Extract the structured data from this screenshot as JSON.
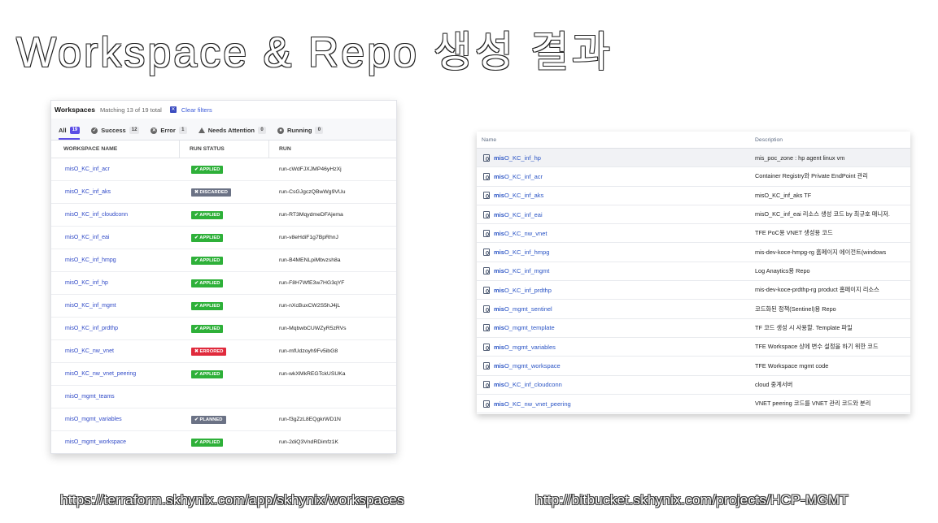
{
  "slide_title": "Workspace & Repo 생성 결과",
  "terraform": {
    "header": {
      "title": "Workspaces",
      "matching": "Matching 13 of 19 total",
      "clear_filters": "Clear filters"
    },
    "tabs": [
      {
        "label": "All",
        "count": "19",
        "icon": ""
      },
      {
        "label": "Success",
        "count": "12",
        "icon": "check-circle-icon"
      },
      {
        "label": "Error",
        "count": "1",
        "icon": "error-circle-icon"
      },
      {
        "label": "Needs Attention",
        "count": "0",
        "icon": "warning-triangle-icon"
      },
      {
        "label": "Running",
        "count": "0",
        "icon": "running-circle-icon"
      }
    ],
    "columns": {
      "name": "WORKSPACE NAME",
      "status": "RUN STATUS",
      "run": "RUN"
    },
    "rows": [
      {
        "name": "misO_KC_inf_acr",
        "status": "APPLIED",
        "status_type": "applied",
        "run": "run-cWdFJXJMP46yHzXj"
      },
      {
        "name": "misO_KC_inf_aks",
        "status": "DISCARDED",
        "status_type": "discarded",
        "run": "run-CsGJgczQBwWg9VUu"
      },
      {
        "name": "misO_KC_inf_cloudconn",
        "status": "APPLIED",
        "status_type": "applied",
        "run": "run-RT3MqydmeDFAjema"
      },
      {
        "name": "misO_KC_inf_eai",
        "status": "APPLIED",
        "status_type": "applied",
        "run": "run-v8eHdiF1g7BpRhnJ"
      },
      {
        "name": "misO_KC_inf_hmpg",
        "status": "APPLIED",
        "status_type": "applied",
        "run": "run-B4MENLpiMbvzsh8a"
      },
      {
        "name": "misO_KC_inf_hp",
        "status": "APPLIED",
        "status_type": "applied",
        "run": "run-F8H7WfE3w7HG3qYF"
      },
      {
        "name": "misO_KC_inf_mgmt",
        "status": "APPLIED",
        "status_type": "applied",
        "run": "run-nXcBuxCW2S5hJ4jL"
      },
      {
        "name": "misO_KC_inf_prdthp",
        "status": "APPLIED",
        "status_type": "applied",
        "run": "run-MqbwbCUWZyR5zRVs"
      },
      {
        "name": "misO_KC_nw_vnet",
        "status": "ERRORED",
        "status_type": "errored",
        "run": "run-mfUdzoyh9Fv5ibG8"
      },
      {
        "name": "misO_KC_nw_vnet_peering",
        "status": "APPLIED",
        "status_type": "applied",
        "run": "run-wkXMkREGTckUSUKa"
      },
      {
        "name": "misO_mgmt_teams",
        "status": "",
        "status_type": "",
        "run": ""
      },
      {
        "name": "misO_mgmt_variables",
        "status": "PLANNED",
        "status_type": "planned",
        "run": "run-f3gZzL8EQgkrWD1N"
      },
      {
        "name": "misO_mgmt_workspace",
        "status": "APPLIED",
        "status_type": "applied",
        "run": "run-2diQ3VndRDimfz1K"
      }
    ]
  },
  "bitbucket": {
    "columns": {
      "name": "Name",
      "description": "Description"
    },
    "rows": [
      {
        "prefix": "mis",
        "rest": "O_KC_inf_hp",
        "description": "mis_poc_zone : hp agent linux vm"
      },
      {
        "prefix": "mis",
        "rest": "O_KC_inf_acr",
        "description": "Container Registry와 Private EndPoint 관리"
      },
      {
        "prefix": "mis",
        "rest": "O_KC_inf_aks",
        "description": "misO_KC_inf_aks TF"
      },
      {
        "prefix": "mis",
        "rest": "O_KC_inf_eai",
        "description": "misO_KC_inf_eai 리소스 생성 코드 by 최규호 매니저."
      },
      {
        "prefix": "mis",
        "rest": "O_KC_nw_vnet",
        "description": "TFE PoC용 VNET 생성용 코드"
      },
      {
        "prefix": "mis",
        "rest": "O_KC_inf_hmpg",
        "description": "mis-dev-koce-hmpg-rg 홈페이지 에이전트(windows"
      },
      {
        "prefix": "mis",
        "rest": "O_KC_inf_mgmt",
        "description": "Log Anaytics용 Repo"
      },
      {
        "prefix": "mis",
        "rest": "O_KC_inf_prdthp",
        "description": "mis-dev-koce-prdthp-rg product 홈페이지 리소스"
      },
      {
        "prefix": "mis",
        "rest": "O_mgmt_sentinel",
        "description": "코드화된 정책(Sentinel)용 Repo"
      },
      {
        "prefix": "mis",
        "rest": "O_mgmt_template",
        "description": "TF 코드 생성 시 사용할. Template 파일"
      },
      {
        "prefix": "mis",
        "rest": "O_mgmt_variables",
        "description": "TFE Workspace 상에 변수 설정을 하기 위한 코드"
      },
      {
        "prefix": "mis",
        "rest": "O_mgmt_workspace",
        "description": "TFE Workspace mgmt code"
      },
      {
        "prefix": "mis",
        "rest": "O_KC_inf_cloudconn",
        "description": "cloud 중계서버"
      },
      {
        "prefix": "mis",
        "rest": "O_KC_nw_vnet_peering",
        "description": "VNET peering 코드를 VNET 관리 코드와 분리"
      }
    ]
  },
  "captions": {
    "left": "https://terraform.skhynix.com/app/skhynix/workspaces",
    "right": "http://bitbucket.skhynix.com/projects/HCP-MGMT"
  },
  "colors": {
    "applied": "#2eb039",
    "discarded": "#6b7285",
    "errored": "#e02a3c",
    "planned": "#6b7285",
    "link": "#2f49c7",
    "tab_active": "#5c4ee5"
  }
}
